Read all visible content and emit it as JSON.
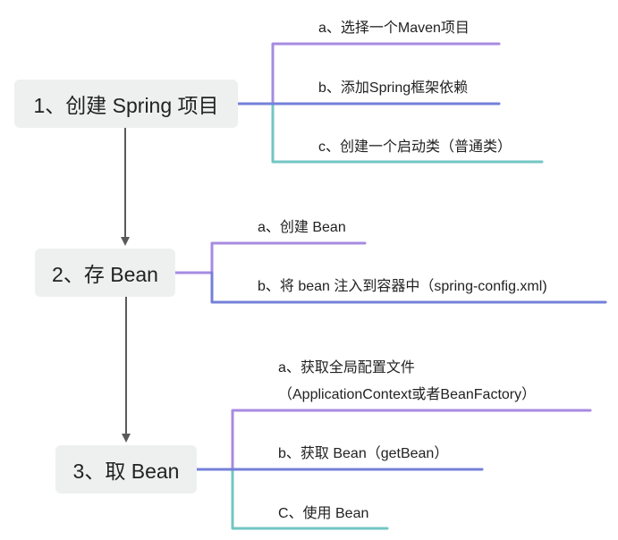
{
  "colors": {
    "purple": "#a78be0",
    "blue": "#7480d8",
    "teal": "#72c6c3",
    "arrow": "#5a5a5a",
    "node_bg": "#eef0f0"
  },
  "steps": [
    {
      "label": "1、创建 Spring 项目",
      "children": [
        {
          "label": "a、选择一个Maven项目",
          "color": "purple"
        },
        {
          "label": "b、添加Spring框架依赖",
          "color": "blue"
        },
        {
          "label": "c、创建一个启动类（普通类）",
          "color": "teal"
        }
      ]
    },
    {
      "label": "2、存 Bean",
      "children": [
        {
          "label": "a、创建 Bean",
          "color": "purple"
        },
        {
          "label": "b、将 bean 注入到容器中（spring-config.xml)",
          "color": "blue"
        }
      ]
    },
    {
      "label": "3、取 Bean",
      "children": [
        {
          "label": "a、获取全局配置文件",
          "label2": "（ApplicationContext或者BeanFactory）",
          "color": "purple"
        },
        {
          "label": "b、获取 Bean（getBean）",
          "color": "blue"
        },
        {
          "label": "C、使用 Bean",
          "color": "teal"
        }
      ]
    }
  ]
}
